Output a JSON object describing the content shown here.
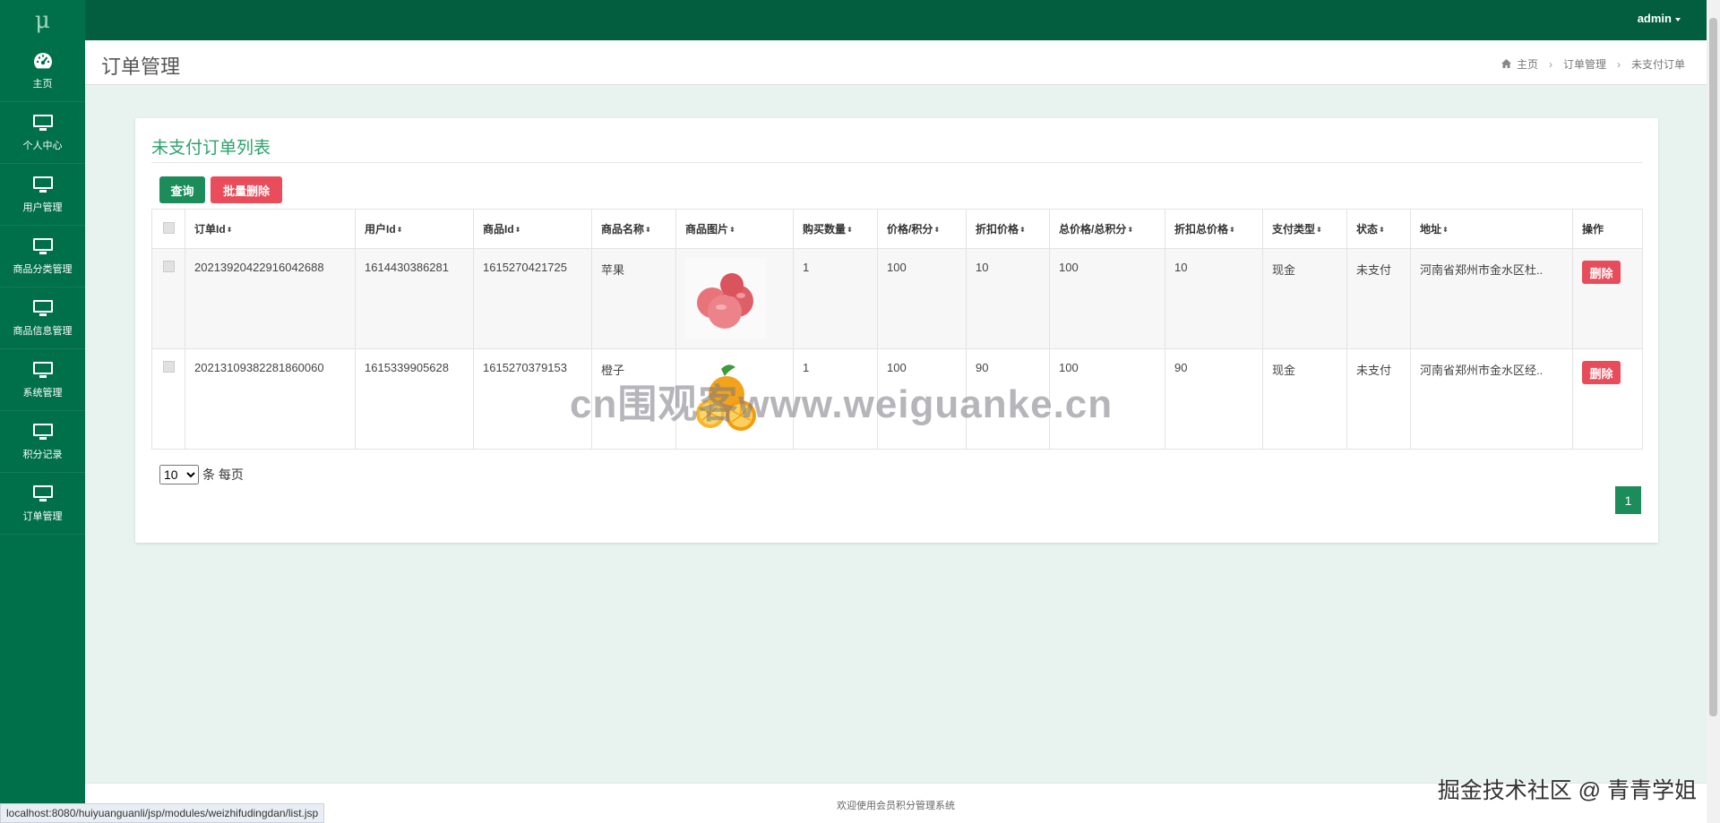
{
  "app": {
    "logo": "μ",
    "user": "admin"
  },
  "sidebar": {
    "items": [
      {
        "label": "主页",
        "icon": "dashboard-icon"
      },
      {
        "label": "个人中心",
        "icon": "monitor-icon"
      },
      {
        "label": "用户管理",
        "icon": "monitor-icon"
      },
      {
        "label": "商品分类管理",
        "icon": "monitor-icon"
      },
      {
        "label": "商品信息管理",
        "icon": "monitor-icon"
      },
      {
        "label": "系统管理",
        "icon": "monitor-icon"
      },
      {
        "label": "积分记录",
        "icon": "monitor-icon"
      },
      {
        "label": "订单管理",
        "icon": "monitor-icon"
      }
    ]
  },
  "header": {
    "title": "订单管理",
    "breadcrumb": [
      "主页",
      "订单管理",
      "未支付订单"
    ]
  },
  "card": {
    "title": "未支付订单列表",
    "query_label": "查询",
    "batch_delete_label": "批量删除"
  },
  "table": {
    "columns": [
      "订单Id",
      "用户Id",
      "商品Id",
      "商品名称",
      "商品图片",
      "购买数量",
      "价格/积分",
      "折扣价格",
      "总价格/总积分",
      "折扣总价格",
      "支付类型",
      "状态",
      "地址",
      "操作"
    ],
    "rows": [
      {
        "order_id": "20213920422916042688",
        "user_id": "1614430386281",
        "goods_id": "1615270421725",
        "goods_name": "苹果",
        "image": "apple-image",
        "qty": "1",
        "price": "100",
        "discount_price": "10",
        "total": "100",
        "discount_total": "10",
        "pay_type": "现金",
        "status": "未支付",
        "address": "河南省郑州市金水区杜..",
        "action": "删除"
      },
      {
        "order_id": "20213109382281860060",
        "user_id": "1615339905628",
        "goods_id": "1615270379153",
        "goods_name": "橙子",
        "image": "orange-image",
        "qty": "1",
        "price": "100",
        "discount_price": "90",
        "total": "100",
        "discount_total": "90",
        "pay_type": "现金",
        "status": "未支付",
        "address": "河南省郑州市金水区经..",
        "action": "删除"
      }
    ]
  },
  "pager": {
    "page_size": "10",
    "page_size_suffix": "条 每页",
    "current_page": "1"
  },
  "footer": {
    "text": "欢迎使用会员积分管理系统"
  },
  "status_bar": {
    "url": "localhost:8080/huiyuanguanli/jsp/modules/weizhifudingdan/list.jsp"
  },
  "overlays": {
    "watermark": "cn围观客www.weiguanke.cn",
    "corner": "掘金技术社区 @ 青青学姐"
  },
  "colors": {
    "sidebar": "#00704a",
    "topbar": "#035e3f",
    "accent": "#2aa26a",
    "danger": "#e84b59",
    "primary_button": "#1c8c5a"
  }
}
